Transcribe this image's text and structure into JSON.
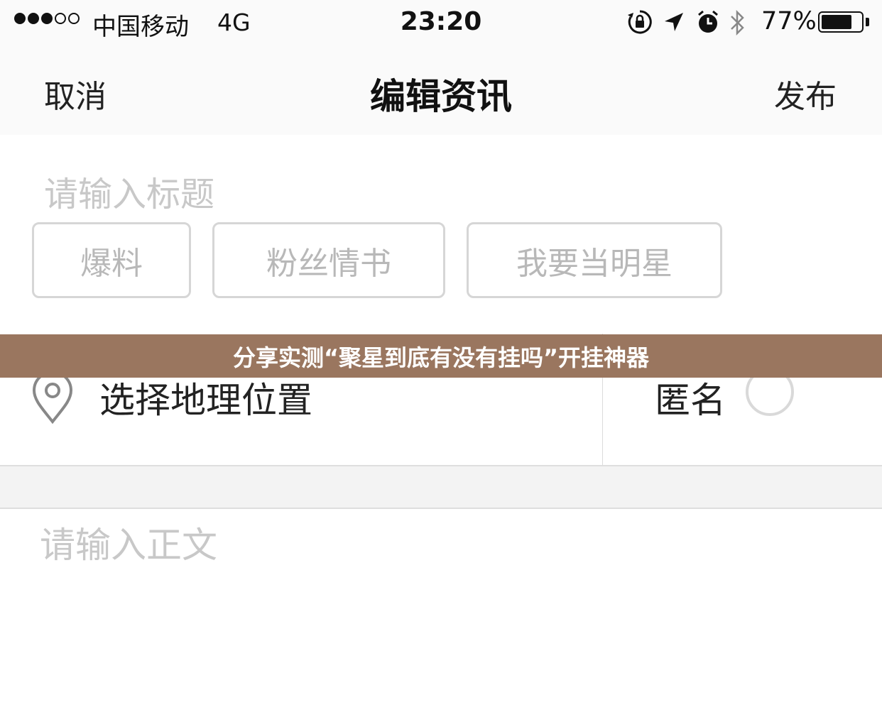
{
  "status_bar": {
    "signal_filled": 3,
    "signal_total": 5,
    "carrier": "中国移动",
    "network": "4G",
    "time": "23:20",
    "icons": [
      "rotation-lock-icon",
      "location-arrow-icon",
      "alarm-icon",
      "bluetooth-icon"
    ],
    "battery_percent": "77%",
    "battery_level": 0.77
  },
  "nav": {
    "cancel_label": "取消",
    "title": "编辑资讯",
    "publish_label": "发布"
  },
  "form": {
    "title_placeholder": "请输入标题",
    "tags": [
      "爆料",
      "粉丝情书",
      "我要当明星"
    ],
    "location_label": "选择地理位置",
    "anonymous_label": "匿名",
    "body_placeholder": "请输入正文"
  },
  "banner": {
    "text": "分享实测“聚星到底有没有挂吗”开挂神器",
    "color": "#9a765f"
  }
}
